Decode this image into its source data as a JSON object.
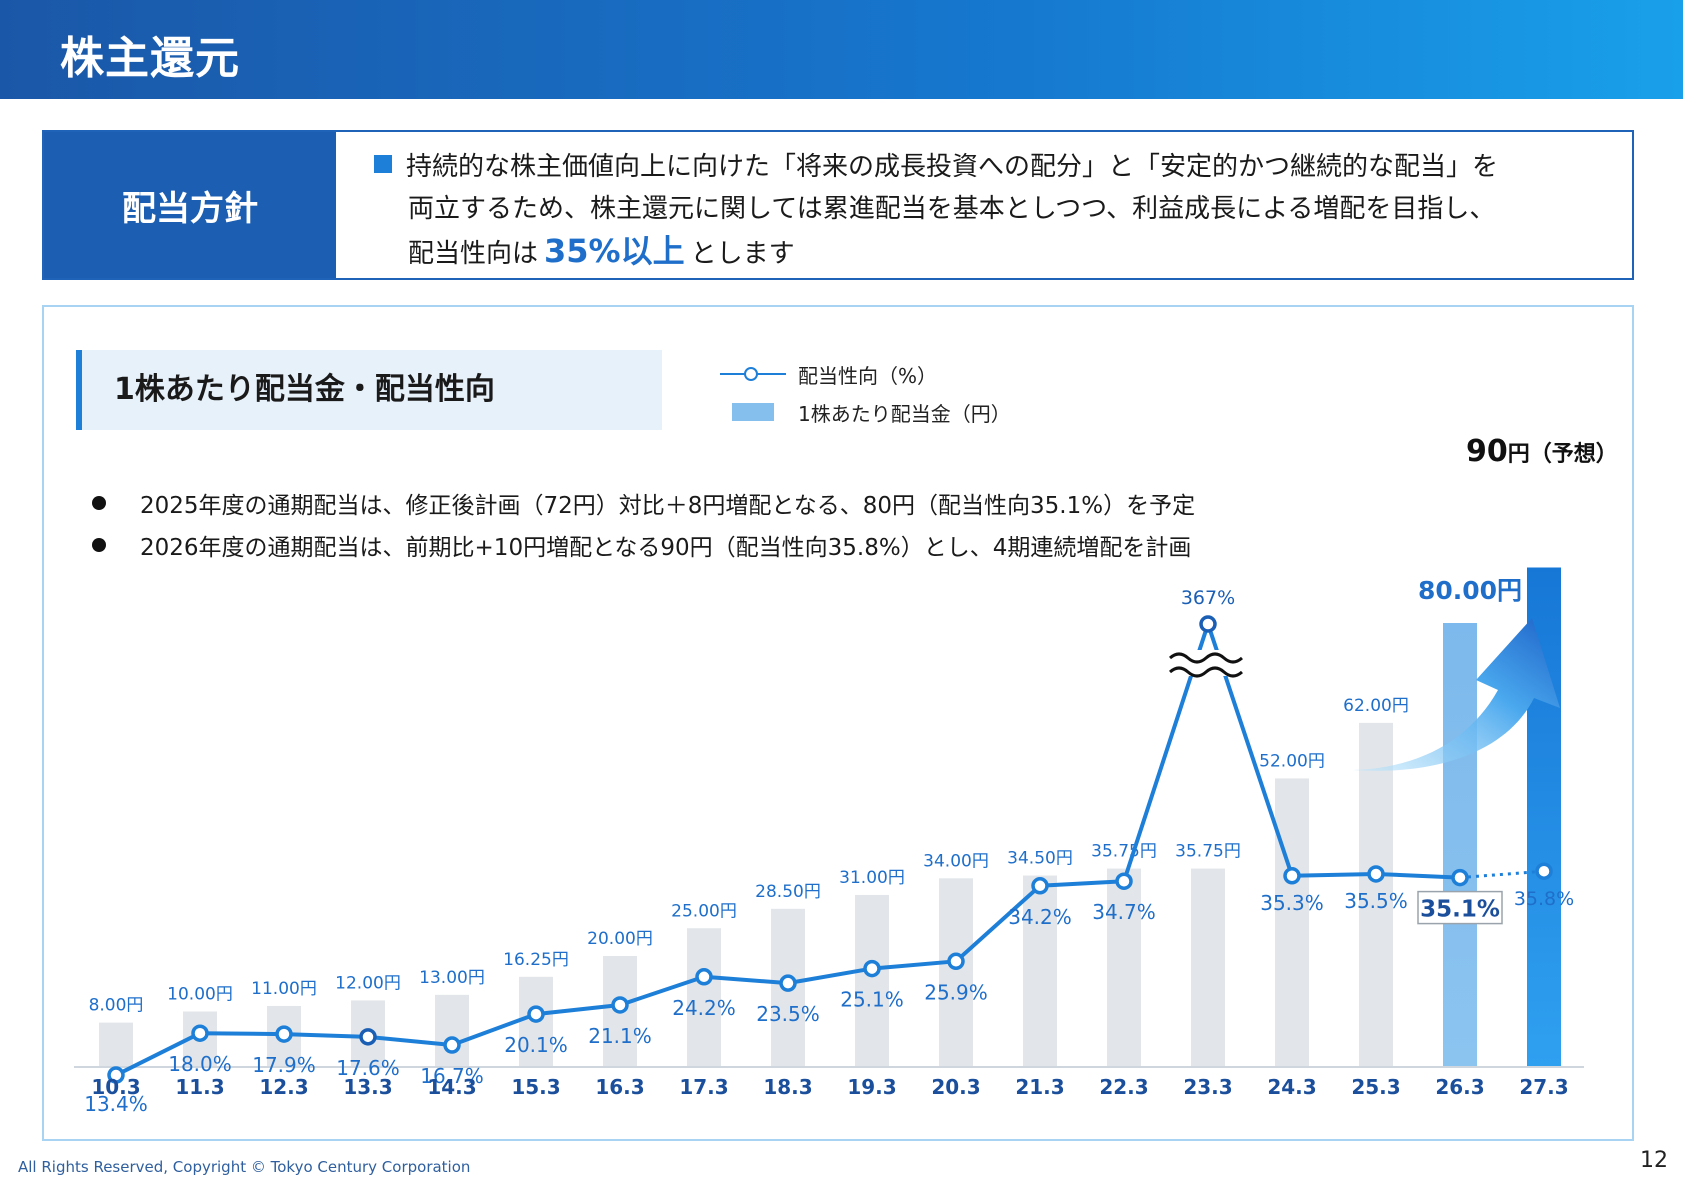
{
  "header": {
    "title": "株主還元"
  },
  "policy": {
    "label": "配当方針",
    "text_line1": "持続的な株主価値向上に向けた「将来の成長投資への配分」と「安定的かつ継続的な配当」を",
    "text_line2": "両立するため、株主還元に関しては累進配当を基本としつつ、利益成長による増配を目指し、",
    "text_line3_pre": "配当性向は",
    "text_highlight": "35%以上",
    "text_line3_post": "とします"
  },
  "section": {
    "title": "1株あたり配当金・配当性向"
  },
  "legend": {
    "line_label": "配当性向（%）",
    "bar_label": "1株あたり配当金（円）"
  },
  "bullets": [
    "2025年度の通期配当は、修正後計画（72円）対比＋8円増配となる、80円（配当性向35.1%）を予定",
    "2026年度の通期配当は、前期比+10円増配となる90円（配当性向35.8%）とし、4期連続増配を計画"
  ],
  "forecast": {
    "value": "90",
    "unit": "円（予想）"
  },
  "colors": {
    "accent": "#1e7fd8",
    "bar": "#e2e6ea",
    "bar_plan": "#84bfee",
    "bar_forecast": "#1e88e5",
    "label_blue": "#1f6fca"
  },
  "chart_data": {
    "type": "bar",
    "categories": [
      "10.3",
      "11.3",
      "12.3",
      "13.3",
      "14.3",
      "15.3",
      "16.3",
      "17.3",
      "18.3",
      "19.3",
      "20.3",
      "21.3",
      "22.3",
      "23.3",
      "24.3",
      "25.3",
      "26.3",
      "27.3"
    ],
    "series": [
      {
        "name": "1株あたり配当金（円）",
        "type": "bar",
        "values": [
          8.0,
          10.0,
          11.0,
          12.0,
          13.0,
          16.25,
          20.0,
          25.0,
          28.5,
          31.0,
          34.0,
          34.5,
          35.75,
          35.75,
          52.0,
          62.0,
          80.0,
          90.0
        ],
        "labels": [
          "8.00円",
          "10.00円",
          "11.00円",
          "12.00円",
          "13.00円",
          "16.25円",
          "20.00円",
          "25.00円",
          "28.50円",
          "31.00円",
          "34.00円",
          "34.50円",
          "35.75円",
          "35.75円",
          "52.00円",
          "62.00円",
          "80.00円",
          ""
        ]
      },
      {
        "name": "配当性向（%）",
        "type": "line",
        "values": [
          13.4,
          18.0,
          17.9,
          17.6,
          16.7,
          20.1,
          21.1,
          24.2,
          23.5,
          25.1,
          25.9,
          34.2,
          34.7,
          367,
          35.3,
          35.5,
          35.1,
          35.8
        ],
        "labels": [
          "13.4%",
          "18.0%",
          "17.9%",
          "17.6%",
          "16.7%",
          "20.1%",
          "21.1%",
          "24.2%",
          "23.5%",
          "25.1%",
          "25.9%",
          "34.2%",
          "34.7%",
          "367%",
          "35.3%",
          "35.5%",
          "35.1%",
          "35.8%"
        ]
      }
    ],
    "ylim": [
      0,
      90
    ]
  },
  "footer": {
    "copyright": "All Rights Reserved, Copyright © Tokyo Century Corporation",
    "page": "12"
  }
}
